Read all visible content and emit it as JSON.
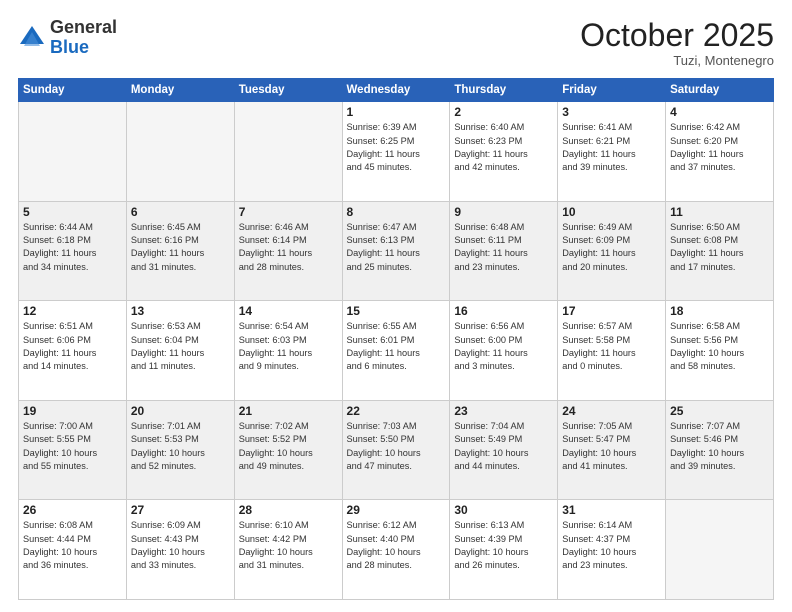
{
  "header": {
    "logo_general": "General",
    "logo_blue": "Blue",
    "month": "October 2025",
    "location": "Tuzi, Montenegro"
  },
  "days_of_week": [
    "Sunday",
    "Monday",
    "Tuesday",
    "Wednesday",
    "Thursday",
    "Friday",
    "Saturday"
  ],
  "weeks": [
    [
      {
        "day": "",
        "info": ""
      },
      {
        "day": "",
        "info": ""
      },
      {
        "day": "",
        "info": ""
      },
      {
        "day": "1",
        "info": "Sunrise: 6:39 AM\nSunset: 6:25 PM\nDaylight: 11 hours\nand 45 minutes."
      },
      {
        "day": "2",
        "info": "Sunrise: 6:40 AM\nSunset: 6:23 PM\nDaylight: 11 hours\nand 42 minutes."
      },
      {
        "day": "3",
        "info": "Sunrise: 6:41 AM\nSunset: 6:21 PM\nDaylight: 11 hours\nand 39 minutes."
      },
      {
        "day": "4",
        "info": "Sunrise: 6:42 AM\nSunset: 6:20 PM\nDaylight: 11 hours\nand 37 minutes."
      }
    ],
    [
      {
        "day": "5",
        "info": "Sunrise: 6:44 AM\nSunset: 6:18 PM\nDaylight: 11 hours\nand 34 minutes."
      },
      {
        "day": "6",
        "info": "Sunrise: 6:45 AM\nSunset: 6:16 PM\nDaylight: 11 hours\nand 31 minutes."
      },
      {
        "day": "7",
        "info": "Sunrise: 6:46 AM\nSunset: 6:14 PM\nDaylight: 11 hours\nand 28 minutes."
      },
      {
        "day": "8",
        "info": "Sunrise: 6:47 AM\nSunset: 6:13 PM\nDaylight: 11 hours\nand 25 minutes."
      },
      {
        "day": "9",
        "info": "Sunrise: 6:48 AM\nSunset: 6:11 PM\nDaylight: 11 hours\nand 23 minutes."
      },
      {
        "day": "10",
        "info": "Sunrise: 6:49 AM\nSunset: 6:09 PM\nDaylight: 11 hours\nand 20 minutes."
      },
      {
        "day": "11",
        "info": "Sunrise: 6:50 AM\nSunset: 6:08 PM\nDaylight: 11 hours\nand 17 minutes."
      }
    ],
    [
      {
        "day": "12",
        "info": "Sunrise: 6:51 AM\nSunset: 6:06 PM\nDaylight: 11 hours\nand 14 minutes."
      },
      {
        "day": "13",
        "info": "Sunrise: 6:53 AM\nSunset: 6:04 PM\nDaylight: 11 hours\nand 11 minutes."
      },
      {
        "day": "14",
        "info": "Sunrise: 6:54 AM\nSunset: 6:03 PM\nDaylight: 11 hours\nand 9 minutes."
      },
      {
        "day": "15",
        "info": "Sunrise: 6:55 AM\nSunset: 6:01 PM\nDaylight: 11 hours\nand 6 minutes."
      },
      {
        "day": "16",
        "info": "Sunrise: 6:56 AM\nSunset: 6:00 PM\nDaylight: 11 hours\nand 3 minutes."
      },
      {
        "day": "17",
        "info": "Sunrise: 6:57 AM\nSunset: 5:58 PM\nDaylight: 11 hours\nand 0 minutes."
      },
      {
        "day": "18",
        "info": "Sunrise: 6:58 AM\nSunset: 5:56 PM\nDaylight: 10 hours\nand 58 minutes."
      }
    ],
    [
      {
        "day": "19",
        "info": "Sunrise: 7:00 AM\nSunset: 5:55 PM\nDaylight: 10 hours\nand 55 minutes."
      },
      {
        "day": "20",
        "info": "Sunrise: 7:01 AM\nSunset: 5:53 PM\nDaylight: 10 hours\nand 52 minutes."
      },
      {
        "day": "21",
        "info": "Sunrise: 7:02 AM\nSunset: 5:52 PM\nDaylight: 10 hours\nand 49 minutes."
      },
      {
        "day": "22",
        "info": "Sunrise: 7:03 AM\nSunset: 5:50 PM\nDaylight: 10 hours\nand 47 minutes."
      },
      {
        "day": "23",
        "info": "Sunrise: 7:04 AM\nSunset: 5:49 PM\nDaylight: 10 hours\nand 44 minutes."
      },
      {
        "day": "24",
        "info": "Sunrise: 7:05 AM\nSunset: 5:47 PM\nDaylight: 10 hours\nand 41 minutes."
      },
      {
        "day": "25",
        "info": "Sunrise: 7:07 AM\nSunset: 5:46 PM\nDaylight: 10 hours\nand 39 minutes."
      }
    ],
    [
      {
        "day": "26",
        "info": "Sunrise: 6:08 AM\nSunset: 4:44 PM\nDaylight: 10 hours\nand 36 minutes."
      },
      {
        "day": "27",
        "info": "Sunrise: 6:09 AM\nSunset: 4:43 PM\nDaylight: 10 hours\nand 33 minutes."
      },
      {
        "day": "28",
        "info": "Sunrise: 6:10 AM\nSunset: 4:42 PM\nDaylight: 10 hours\nand 31 minutes."
      },
      {
        "day": "29",
        "info": "Sunrise: 6:12 AM\nSunset: 4:40 PM\nDaylight: 10 hours\nand 28 minutes."
      },
      {
        "day": "30",
        "info": "Sunrise: 6:13 AM\nSunset: 4:39 PM\nDaylight: 10 hours\nand 26 minutes."
      },
      {
        "day": "31",
        "info": "Sunrise: 6:14 AM\nSunset: 4:37 PM\nDaylight: 10 hours\nand 23 minutes."
      },
      {
        "day": "",
        "info": ""
      }
    ]
  ]
}
